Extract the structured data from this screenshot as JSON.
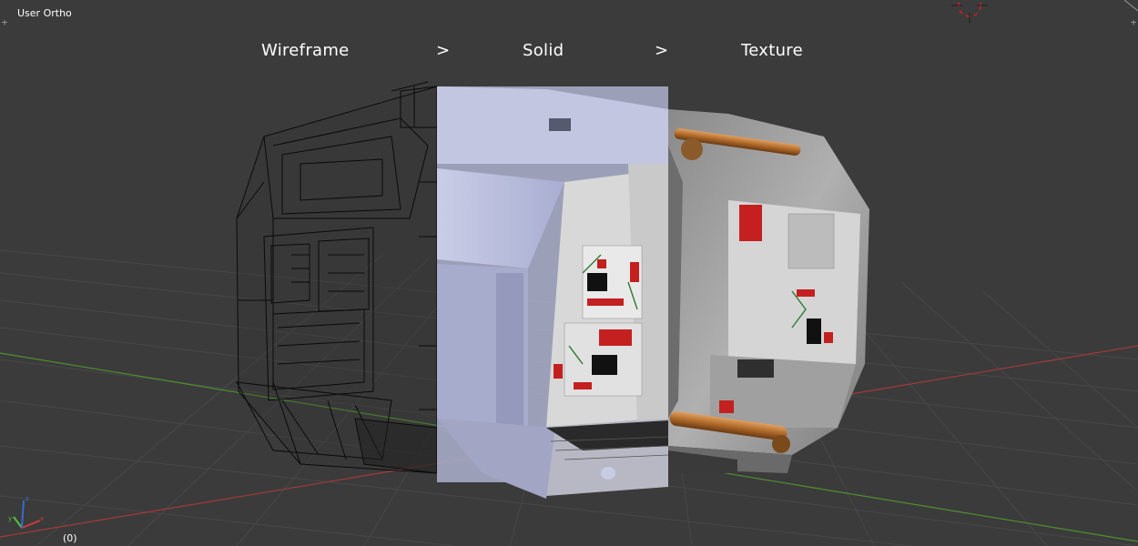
{
  "viewport": {
    "view_label": "User Ortho",
    "frame_indicator": "(0)",
    "background": "#3b3b3b",
    "grid_color": "#464646",
    "x_axis_color": "#a33a3a",
    "y_axis_color": "#4f8f2f"
  },
  "stages": {
    "wireframe": "Wireframe",
    "arrow1": ">",
    "solid": "Solid",
    "arrow2": ">",
    "texture": "Texture"
  },
  "axis_gizmo": {
    "x_label": "x",
    "y_label": "y",
    "z_label": "z",
    "x_color": "#d03a3a",
    "y_color": "#4fbf3f",
    "z_color": "#3a6ad0"
  },
  "icons": {
    "corner_top_left": "plus-handle-icon",
    "corner_top_right": "plus-handle-icon",
    "cursor": "3d-cursor-icon"
  }
}
